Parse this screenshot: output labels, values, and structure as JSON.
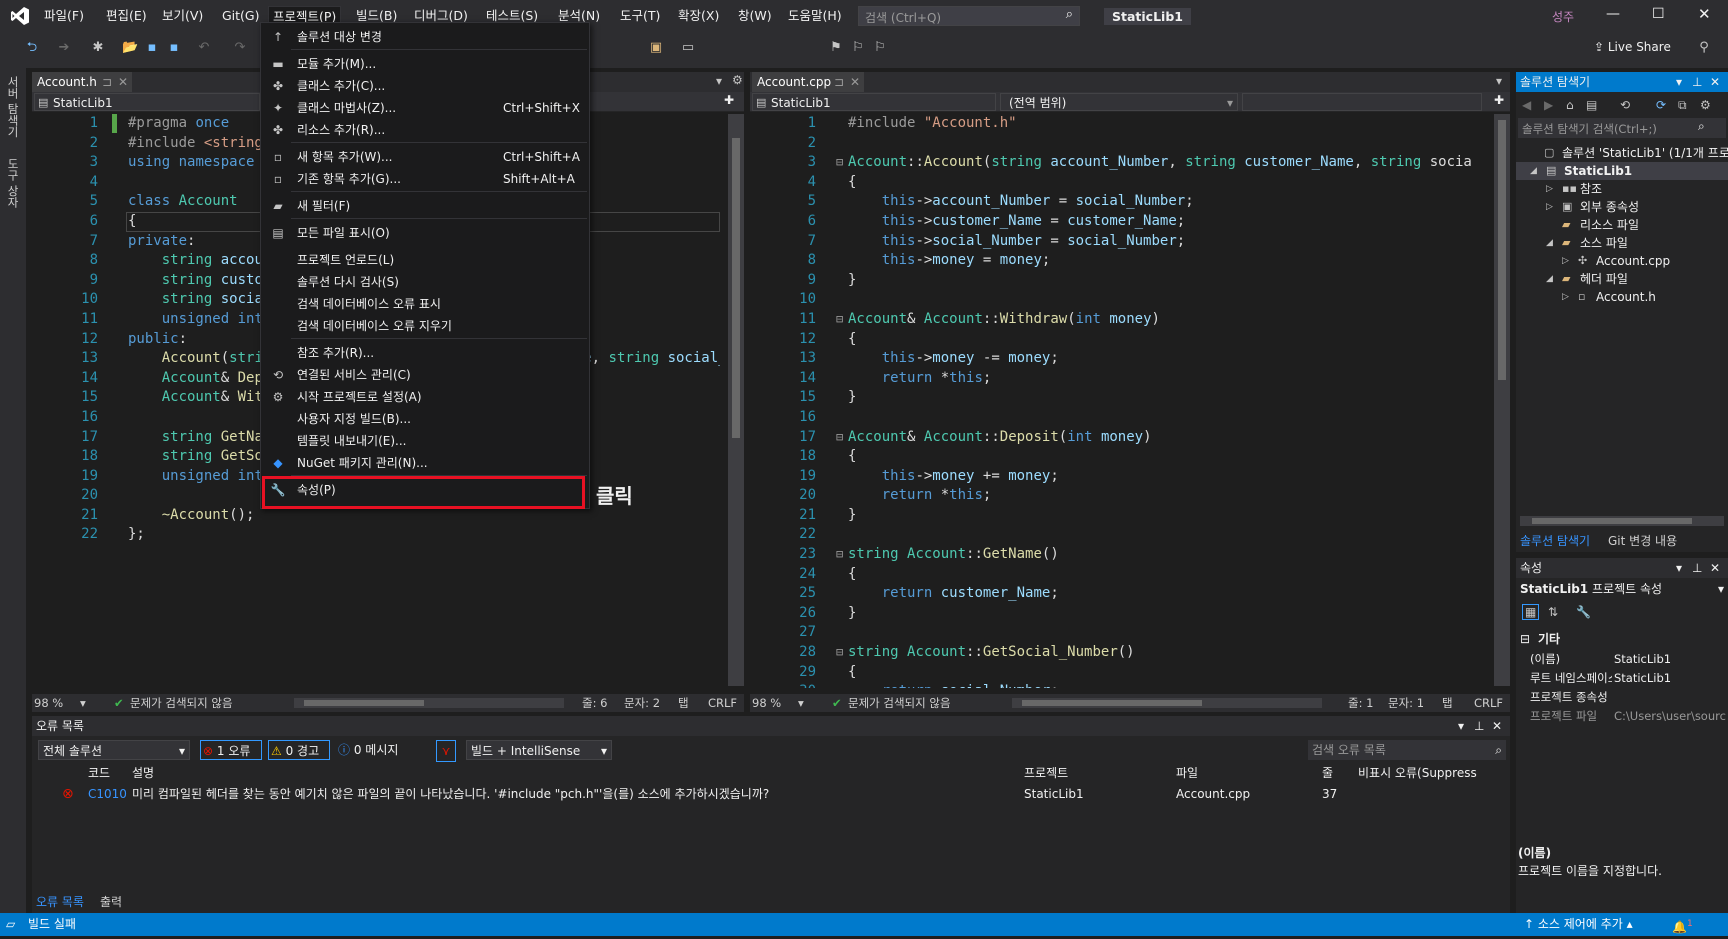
{
  "menubar": {
    "items": [
      "파일(F)",
      "편집(E)",
      "보기(V)",
      "Git(G)",
      "프로젝트(P)",
      "빌드(B)",
      "디버그(D)",
      "테스트(S)",
      "분석(N)",
      "도구(T)",
      "확장(X)",
      "창(W)",
      "도움말(H)"
    ],
    "search_placeholder": "검색 (Ctrl+Q)",
    "solution_name": "StaticLib1",
    "user_initials": "성주",
    "live_share": "Live Share"
  },
  "left_tabs": [
    "서버 탐색기",
    "도구 상자"
  ],
  "project_menu": {
    "items": [
      {
        "label": "솔루션 대상 변경",
        "shortcut": "",
        "icon": "arrow-up-icon"
      },
      {
        "label": "모듈 추가(M)...",
        "shortcut": "",
        "icon": "module-icon"
      },
      {
        "label": "클래스 추가(C)...",
        "shortcut": "",
        "icon": "class-icon"
      },
      {
        "label": "클래스 마법사(Z)...",
        "shortcut": "Ctrl+Shift+X",
        "icon": "wizard-icon"
      },
      {
        "label": "리소스 추가(R)...",
        "shortcut": "",
        "icon": "resource-icon"
      },
      {
        "label": "새 항목 추가(W)...",
        "shortcut": "Ctrl+Shift+A",
        "icon": "new-item-icon"
      },
      {
        "label": "기존 항목 추가(G)...",
        "shortcut": "Shift+Alt+A",
        "icon": "existing-item-icon"
      },
      {
        "label": "새 필터(F)",
        "shortcut": "",
        "icon": "folder-icon"
      },
      {
        "label": "모든 파일 표시(O)",
        "shortcut": "",
        "icon": "show-files-icon"
      },
      {
        "label": "프로젝트 언로드(L)",
        "shortcut": "",
        "icon": ""
      },
      {
        "label": "솔루션 다시 검사(S)",
        "shortcut": "",
        "icon": ""
      },
      {
        "label": "검색 데이터베이스 오류 표시",
        "shortcut": "",
        "icon": ""
      },
      {
        "label": "검색 데이터베이스 오류 지우기",
        "shortcut": "",
        "icon": ""
      },
      {
        "label": "참조 추가(R)...",
        "shortcut": "",
        "icon": ""
      },
      {
        "label": "연결된 서비스 관리(C)",
        "shortcut": "",
        "icon": "services-icon"
      },
      {
        "label": "시작 프로젝트로 설정(A)",
        "shortcut": "",
        "icon": "gear-icon"
      },
      {
        "label": "사용자 지정 빌드(B)...",
        "shortcut": "",
        "icon": ""
      },
      {
        "label": "템플릿 내보내기(E)...",
        "shortcut": "",
        "icon": ""
      },
      {
        "label": "NuGet 패키지 관리(N)...",
        "shortcut": "",
        "icon": "nuget-icon"
      },
      {
        "label": "속성(P)",
        "shortcut": "",
        "icon": "wrench-icon"
      }
    ],
    "annotation": "클릭"
  },
  "left_editor": {
    "tab": "Account.h",
    "nav_project": "StaticLib1",
    "zoom": "98 %",
    "status": "문제가 검색되지 않음",
    "line": "줄: 6",
    "col": "문자: 2",
    "tab_mode": "탭",
    "eol": "CRLF",
    "lines": [
      "#pragma once",
      "#include <string>",
      "using namespace std;",
      "",
      "class Account",
      "{",
      "private:",
      "    string account_Number;",
      "    string customer_Name;",
      "    string social_Number;",
      "    unsigned int money;",
      "public:",
      "    Account(string account_Number, string customer_Name, string social_Number, unsigned int money);",
      "    Account& Deposit(int money);",
      "    Account& Withdraw(int money);",
      "",
      "    string GetName();",
      "    string GetSocial_Number();",
      "    unsigned int GetMoney();",
      "",
      "    ~Account();",
      "};"
    ]
  },
  "right_editor": {
    "tab": "Account.cpp",
    "nav_project": "StaticLib1",
    "nav_scope": "(전역 범위)",
    "zoom": "98 %",
    "status": "문제가 검색되지 않음",
    "line": "줄: 1",
    "col": "문자: 1",
    "tab_mode": "탭",
    "eol": "CRLF",
    "lines": [
      "#include \"Account.h\"",
      "",
      "Account::Account(string account_Number, string customer_Name, string socia",
      "{",
      "    this->account_Number = social_Number;",
      "    this->customer_Name = customer_Name;",
      "    this->social_Number = social_Number;",
      "    this->money = money;",
      "}",
      "",
      "Account& Account::Withdraw(int money)",
      "{",
      "    this->money -= money;",
      "    return *this;",
      "}",
      "",
      "Account& Account::Deposit(int money)",
      "{",
      "    this->money += money;",
      "    return *this;",
      "}",
      "",
      "string Account::GetName()",
      "{",
      "    return customer_Name;",
      "}",
      "",
      "string Account::GetSocial_Number()",
      "{",
      "    return social_Number;"
    ]
  },
  "solution_explorer": {
    "title": "솔루션 탐색기",
    "search_placeholder": "솔루션 탐색기 검색(Ctrl+;)",
    "root": "솔루션 'StaticLib1' (1/1개 프로젝트)",
    "project": "StaticLib1",
    "nodes": [
      "참조",
      "외부 종속성",
      "리소스 파일",
      "소스 파일",
      "Account.cpp",
      "헤더 파일",
      "Account.h"
    ],
    "bottom_tabs": [
      "솔루션 탐색기",
      "Git 변경 내용"
    ]
  },
  "properties": {
    "title": "속성",
    "object": "StaticLib1",
    "object_type": "프로젝트 속성",
    "category": "기타",
    "rows": [
      {
        "name": "(이름)",
        "value": "StaticLib1"
      },
      {
        "name": "루트 네임스페이스",
        "value": "StaticLib1"
      },
      {
        "name": "프로젝트 종속성",
        "value": ""
      },
      {
        "name": "프로젝트 파일",
        "value": "C:\\Users\\user\\source"
      }
    ],
    "desc_title": "(이름)",
    "desc_text": "프로젝트 이름을 지정합니다."
  },
  "error_list": {
    "title": "오류 목록",
    "scope": "전체 솔루션",
    "errors": "1 오류",
    "warnings": "0 경고",
    "messages": "0 메시지",
    "source": "빌드 + IntelliSense",
    "search_placeholder": "검색 오류 목록",
    "columns": [
      "코드",
      "설명",
      "프로젝트",
      "파일",
      "줄",
      "비표시 오류(Suppress"
    ],
    "rows": [
      {
        "code": "C1010",
        "desc": "미리 컴파일된 헤더를 찾는 동안 예기치 않은 파일의 끝이 나타났습니다. '#include \"pch.h\"'을(를) 소스에 추가하시겠습니까?",
        "project": "StaticLib1",
        "file": "Account.cpp",
        "line": "37"
      }
    ],
    "bottom_tabs": [
      "오류 목록",
      "출력"
    ]
  },
  "statusbar": {
    "text": "빌드 실패",
    "source_control": "소스 제어에 추가",
    "notifications": "1"
  },
  "colors": {
    "accent": "#007acc",
    "highlight": "#e81123",
    "bg": "#1e1e1e"
  }
}
